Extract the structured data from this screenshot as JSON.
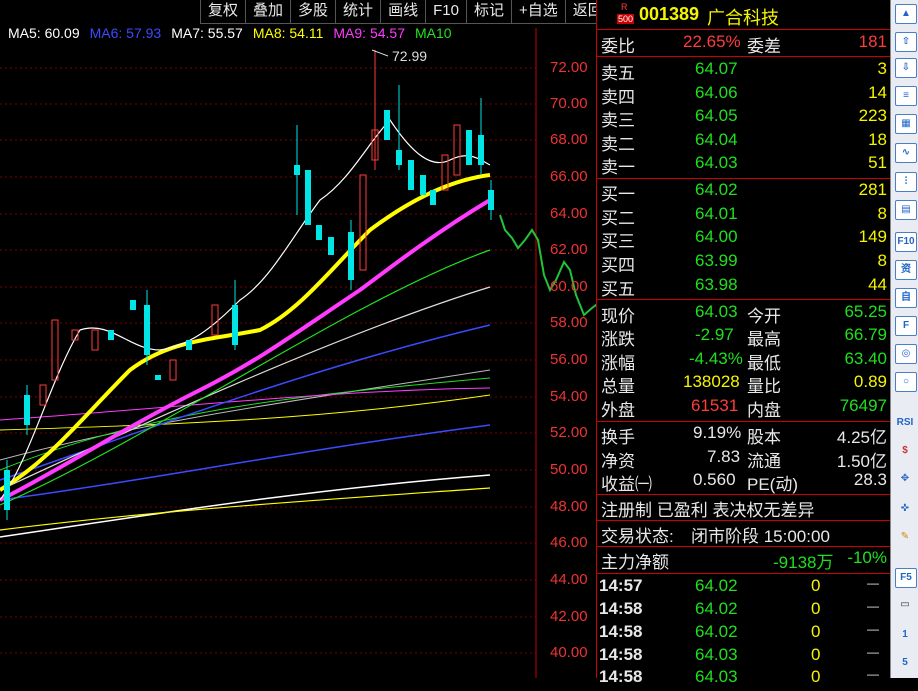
{
  "toolbar": [
    "复权",
    "叠加",
    "多股",
    "统计",
    "画线",
    "F10",
    "标记",
    "+自选",
    "返回"
  ],
  "ma": [
    {
      "label": "MA5: 60.09",
      "color": "#ffffff"
    },
    {
      "label": "MA6: 57.93",
      "color": "#3b4bff"
    },
    {
      "label": "MA7: 55.57",
      "color": "#ffffff"
    },
    {
      "label": "MA8: 54.11",
      "color": "#ffff00"
    },
    {
      "label": "MA9: 54.57",
      "color": "#ff3bff"
    },
    {
      "label": "MA10",
      "color": "#22e022"
    }
  ],
  "price_axis": [
    "72.00",
    "70.00",
    "68.00",
    "66.00",
    "64.00",
    "62.00",
    "60.00",
    "58.00",
    "56.00",
    "54.00",
    "52.00",
    "50.00",
    "48.00",
    "46.00",
    "44.00",
    "42.00",
    "40.00"
  ],
  "high_marker": "72.99",
  "stock": {
    "code": "001389",
    "name": "广合科技",
    "badge_top": "R",
    "badge_bottom": "500"
  },
  "webi": {
    "label1": "委比",
    "val1": "22.65%",
    "label2": "委差",
    "val2": "181"
  },
  "asks": [
    {
      "label": "卖五",
      "price": "64.07",
      "vol": "3"
    },
    {
      "label": "卖四",
      "price": "64.06",
      "vol": "14"
    },
    {
      "label": "卖三",
      "price": "64.05",
      "vol": "223"
    },
    {
      "label": "卖二",
      "price": "64.04",
      "vol": "18"
    },
    {
      "label": "卖一",
      "price": "64.03",
      "vol": "51"
    }
  ],
  "bids": [
    {
      "label": "买一",
      "price": "64.02",
      "vol": "281"
    },
    {
      "label": "买二",
      "price": "64.01",
      "vol": "8"
    },
    {
      "label": "买三",
      "price": "64.00",
      "vol": "149"
    },
    {
      "label": "买四",
      "price": "63.99",
      "vol": "8"
    },
    {
      "label": "买五",
      "price": "63.98",
      "vol": "44"
    }
  ],
  "quote": [
    {
      "l1": "现价",
      "v1": "64.03",
      "c1": "green",
      "l2": "今开",
      "v2": "65.25",
      "c2": "green"
    },
    {
      "l1": "涨跌",
      "v1": "-2.97",
      "c1": "green",
      "l2": "最高",
      "v2": "66.79",
      "c2": "green"
    },
    {
      "l1": "涨幅",
      "v1": "-4.43%",
      "c1": "green",
      "l2": "最低",
      "v2": "63.40",
      "c2": "green"
    },
    {
      "l1": "总量",
      "v1": "138028",
      "c1": "yellow",
      "l2": "量比",
      "v2": "0.89",
      "c2": "yellow"
    },
    {
      "l1": "外盘",
      "v1": "61531",
      "c1": "red",
      "l2": "内盘",
      "v2": "76497",
      "c2": "green"
    }
  ],
  "fund": [
    {
      "l1": "换手",
      "v1": "9.19%",
      "l2": "股本",
      "v2": "4.25亿"
    },
    {
      "l1": "净资",
      "v1": "7.83",
      "l2": "流通",
      "v2": "1.50亿"
    },
    {
      "l1": "收益㈠",
      "v1": "0.560",
      "l2": "PE(动)",
      "v2": "28.3"
    }
  ],
  "tags": "注册制 已盈利 表决权无差异",
  "trade_status": {
    "label": "交易状态:",
    "value": "闭市阶段 15:00:00"
  },
  "main_flow": {
    "label": "主力净额",
    "value": "-9138万",
    "pct": "-10%"
  },
  "ticks": [
    {
      "time": "14:57",
      "price": "64.02",
      "vol": "0",
      "dir": "—"
    },
    {
      "time": "14:58",
      "price": "64.02",
      "vol": "0",
      "dir": "—"
    },
    {
      "time": "14:58",
      "price": "64.02",
      "vol": "0",
      "dir": "—"
    },
    {
      "time": "14:58",
      "price": "64.03",
      "vol": "0",
      "dir": "—"
    },
    {
      "time": "14:58",
      "price": "64.03",
      "vol": "0",
      "dir": "—"
    }
  ],
  "rightbar": [
    "F10",
    "F5",
    "1",
    "5"
  ],
  "colors": {
    "up": "#ff3b3b",
    "down": "#00e5e5",
    "ma5": "#ffffff",
    "ma10": "#ffff00",
    "ma20": "#ff3bff",
    "ma30": "#22e022",
    "grid": "#8b0000"
  }
}
